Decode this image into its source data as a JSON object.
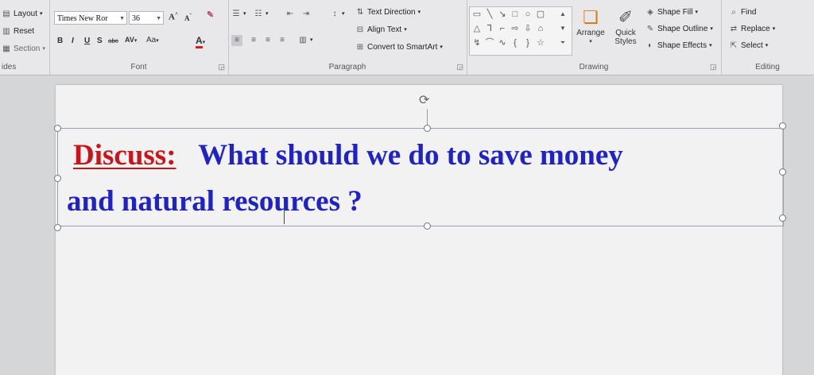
{
  "slides_group": {
    "layout_label": "Layout",
    "reset_label": "Reset",
    "section_label": "Section",
    "group_label": "ides"
  },
  "font_group": {
    "font_name": "Times New Ror",
    "font_size": "36",
    "bold": "B",
    "italic": "I",
    "underline": "U",
    "shadow": "S",
    "strikethrough": "abc",
    "spacing": "AV",
    "change_case": "Aa",
    "font_color": "A",
    "grow": "A",
    "shrink": "A",
    "group_label": "Font"
  },
  "paragraph_group": {
    "text_direction": "Text Direction",
    "align_text": "Align Text",
    "convert_smartart": "Convert to SmartArt",
    "group_label": "Paragraph"
  },
  "drawing_group": {
    "arrange": "Arrange",
    "quick_styles": "Quick Styles",
    "shape_fill": "Shape Fill",
    "shape_outline": "Shape Outline",
    "shape_effects": "Shape Effects",
    "group_label": "Drawing"
  },
  "editing_group": {
    "find": "Find",
    "replace": "Replace",
    "select": "Select",
    "group_label": "Editing"
  },
  "slide": {
    "discuss_label": "Discuss:",
    "question_line1": "What should we do to save money",
    "question_line2": "and natural resources ?"
  },
  "colors": {
    "discuss": "#c8151b",
    "question": "#1f23c4"
  }
}
